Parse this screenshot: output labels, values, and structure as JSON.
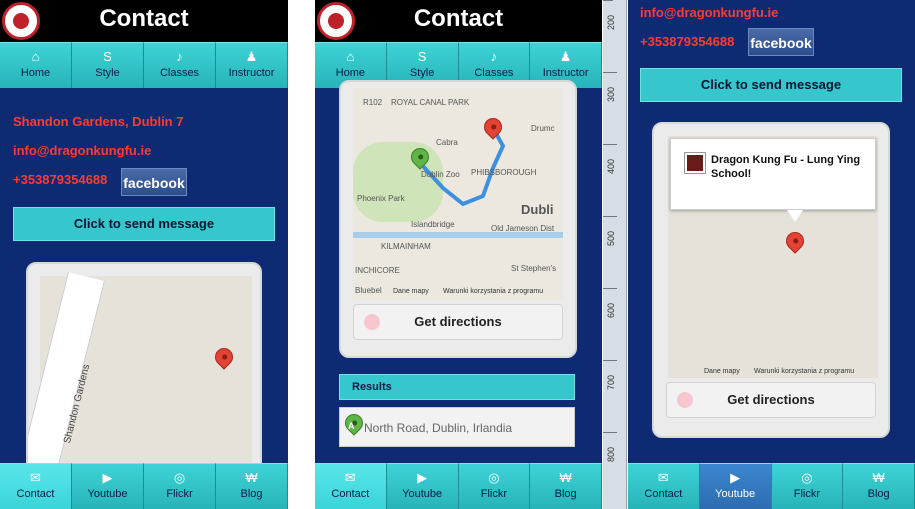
{
  "panel1": {
    "header": {
      "title": "Contact"
    },
    "nav_top": [
      {
        "icon": "home-icon",
        "glyph": "⌂",
        "label": "Home"
      },
      {
        "icon": "style-icon",
        "glyph": "S",
        "label": "Style"
      },
      {
        "icon": "bell-icon",
        "glyph": "♪",
        "label": "Classes"
      },
      {
        "icon": "person-icon",
        "glyph": "♟",
        "label": "Instructor"
      }
    ],
    "address": "Shandon Gardens, Dublin 7",
    "email": "info@dragonkungfu.ie",
    "phone": "+353879354688",
    "facebook": "facebook",
    "send_button": "Click to send message",
    "map_street": "Shandon Gardens",
    "nav_bottom": [
      {
        "icon": "mail-icon",
        "glyph": "✉",
        "label": "Contact"
      },
      {
        "icon": "youtube-icon",
        "glyph": "▶",
        "label": "Youtube"
      },
      {
        "icon": "flickr-icon",
        "glyph": "◎",
        "label": "Flickr"
      },
      {
        "icon": "blog-icon",
        "glyph": "₩",
        "label": "Blog"
      }
    ]
  },
  "panel2": {
    "header": {
      "title": "Contact"
    },
    "nav_top": [
      {
        "label": "Home"
      },
      {
        "label": "Style"
      },
      {
        "label": "Classes"
      },
      {
        "label": "Instructor"
      }
    ],
    "map_labels": [
      "R102",
      "ROYAL CANAL PARK",
      "Cabra",
      "Drumc",
      "Dublin Zoo",
      "PHIBSBOROUGH",
      "Phoenix Park",
      "Dubli",
      "Islandbridge",
      "Old Jameson Dist",
      "KILMAINHAM",
      "St Stephen's",
      "INCHICORE",
      "Bluebel"
    ],
    "map_footer": [
      "Dane mapy",
      "Warunki korzystania z programu"
    ],
    "directions_button": "Get directions",
    "results_header": "Results",
    "result_item": "North Road, Dublin, Irlandia",
    "result_marker": "A",
    "nav_bottom": [
      {
        "label": "Contact"
      },
      {
        "label": "Youtube"
      },
      {
        "label": "Flickr"
      },
      {
        "label": "Blog"
      }
    ]
  },
  "panel3": {
    "email": "info@dragonkungfu.ie",
    "phone": "+353879354688",
    "facebook": "facebook",
    "send_button": "Click to send message",
    "infowindow_title": "Dragon Kung Fu - Lung Ying School!",
    "map_footer": [
      "Dane mapy",
      "Warunki korzystania z programu"
    ],
    "directions_button": "Get directions",
    "ruler_labels": [
      "200",
      "300",
      "400",
      "500",
      "600",
      "700",
      "800"
    ],
    "nav_bottom": [
      {
        "label": "Contact"
      },
      {
        "label": "Youtube"
      },
      {
        "label": "Flickr"
      },
      {
        "label": "Blog"
      }
    ]
  },
  "colors": {
    "page_bg": "#0d2a73",
    "nav_teal": "#2bbfc4",
    "red_text": "#ff3a30",
    "active_blue": "#2d6cb1"
  }
}
